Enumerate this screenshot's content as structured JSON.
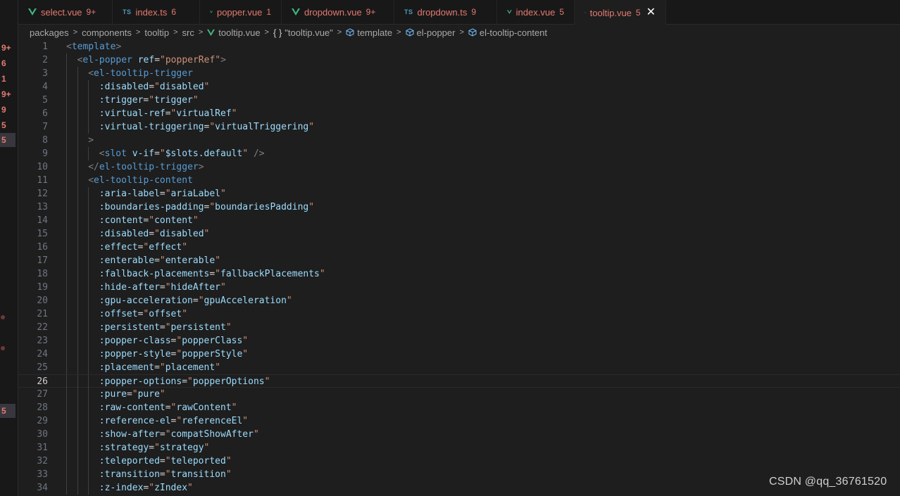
{
  "left_strip": {
    "badges": [
      "9+",
      "6",
      "1",
      "9+",
      "9",
      "5",
      "5"
    ],
    "extra_badge": "5"
  },
  "tabs": [
    {
      "icon": "vue-icon",
      "label": "select.vue",
      "badge": "9+",
      "active": false
    },
    {
      "icon": "ts-icon",
      "icon_text": "TS",
      "label": "index.ts",
      "badge": "6",
      "active": false
    },
    {
      "icon": "vue-icon",
      "label": "popper.vue",
      "badge": "1",
      "active": false
    },
    {
      "icon": "vue-icon",
      "label": "dropdown.vue",
      "badge": "9+",
      "active": false
    },
    {
      "icon": "ts-icon",
      "icon_text": "TS",
      "label": "dropdown.ts",
      "badge": "9",
      "active": false
    },
    {
      "icon": "vue-icon",
      "label": "index.vue",
      "badge": "5",
      "active": false
    },
    {
      "icon": "vue-icon",
      "label": "tooltip.vue",
      "badge": "5",
      "active": true,
      "close": "✕"
    }
  ],
  "breadcrumb": {
    "packages": "packages",
    "components": "components",
    "tooltip": "tooltip",
    "src": "src",
    "file": "tooltip.vue",
    "braces": "{ }",
    "sfc": "\"tooltip.vue\"",
    "template": "template",
    "popper": "el-popper",
    "content": "el-tooltip-content"
  },
  "editor": {
    "current_line": 26,
    "lines": [
      {
        "n": "1",
        "i": 0,
        "tokens": [
          [
            "t-punc",
            "<"
          ],
          [
            "t-tag",
            "template"
          ],
          [
            "t-punc",
            ">"
          ]
        ]
      },
      {
        "n": "2",
        "i": 1,
        "tokens": [
          [
            "t-punc",
            "<"
          ],
          [
            "t-tag",
            "el-popper"
          ],
          [
            "t-text",
            " "
          ],
          [
            "t-attr",
            "ref"
          ],
          [
            "t-text",
            "="
          ],
          [
            "t-str",
            "\"popperRef\""
          ],
          [
            "t-punc",
            ">"
          ]
        ]
      },
      {
        "n": "3",
        "i": 2,
        "tokens": [
          [
            "t-punc",
            "<"
          ],
          [
            "t-tag",
            "el-tooltip-trigger"
          ]
        ]
      },
      {
        "n": "4",
        "i": 3,
        "tokens": [
          [
            "t-dir",
            ":disabled"
          ],
          [
            "t-text",
            "="
          ],
          [
            "t-str",
            "\""
          ],
          [
            "t-attr",
            "disabled"
          ],
          [
            "t-str",
            "\""
          ]
        ]
      },
      {
        "n": "5",
        "i": 3,
        "tokens": [
          [
            "t-dir",
            ":trigger"
          ],
          [
            "t-text",
            "="
          ],
          [
            "t-str",
            "\""
          ],
          [
            "t-attr",
            "trigger"
          ],
          [
            "t-str",
            "\""
          ]
        ]
      },
      {
        "n": "6",
        "i": 3,
        "tokens": [
          [
            "t-dir",
            ":virtual-ref"
          ],
          [
            "t-text",
            "="
          ],
          [
            "t-str",
            "\""
          ],
          [
            "t-attr",
            "virtualRef"
          ],
          [
            "t-str",
            "\""
          ]
        ]
      },
      {
        "n": "7",
        "i": 3,
        "tokens": [
          [
            "t-dir",
            ":virtual-triggering"
          ],
          [
            "t-text",
            "="
          ],
          [
            "t-str",
            "\""
          ],
          [
            "t-attr",
            "virtualTriggering"
          ],
          [
            "t-str",
            "\""
          ]
        ]
      },
      {
        "n": "8",
        "i": 2,
        "tokens": [
          [
            "t-punc",
            ">"
          ]
        ]
      },
      {
        "n": "9",
        "i": 3,
        "tokens": [
          [
            "t-punc",
            "<"
          ],
          [
            "t-tag",
            "slot"
          ],
          [
            "t-text",
            " "
          ],
          [
            "t-attr",
            "v-if"
          ],
          [
            "t-text",
            "="
          ],
          [
            "t-str",
            "\""
          ],
          [
            "t-attr",
            "$slots.default"
          ],
          [
            "t-str",
            "\""
          ],
          [
            "t-text",
            " "
          ],
          [
            "t-punc",
            "/>"
          ]
        ]
      },
      {
        "n": "10",
        "i": 2,
        "tokens": [
          [
            "t-punc",
            "</"
          ],
          [
            "t-tag",
            "el-tooltip-trigger"
          ],
          [
            "t-punc",
            ">"
          ]
        ]
      },
      {
        "n": "11",
        "i": 2,
        "tokens": [
          [
            "t-punc",
            "<"
          ],
          [
            "t-tag",
            "el-tooltip-content"
          ]
        ]
      },
      {
        "n": "12",
        "i": 3,
        "tokens": [
          [
            "t-dir",
            ":aria-label"
          ],
          [
            "t-text",
            "="
          ],
          [
            "t-str",
            "\""
          ],
          [
            "t-attr",
            "ariaLabel"
          ],
          [
            "t-str",
            "\""
          ]
        ]
      },
      {
        "n": "13",
        "i": 3,
        "tokens": [
          [
            "t-dir",
            ":boundaries-padding"
          ],
          [
            "t-text",
            "="
          ],
          [
            "t-str",
            "\""
          ],
          [
            "t-attr",
            "boundariesPadding"
          ],
          [
            "t-str",
            "\""
          ]
        ]
      },
      {
        "n": "14",
        "i": 3,
        "tokens": [
          [
            "t-dir",
            ":content"
          ],
          [
            "t-text",
            "="
          ],
          [
            "t-str",
            "\""
          ],
          [
            "t-attr",
            "content"
          ],
          [
            "t-str",
            "\""
          ]
        ]
      },
      {
        "n": "15",
        "i": 3,
        "tokens": [
          [
            "t-dir",
            ":disabled"
          ],
          [
            "t-text",
            "="
          ],
          [
            "t-str",
            "\""
          ],
          [
            "t-attr",
            "disabled"
          ],
          [
            "t-str",
            "\""
          ]
        ]
      },
      {
        "n": "16",
        "i": 3,
        "tokens": [
          [
            "t-dir",
            ":effect"
          ],
          [
            "t-text",
            "="
          ],
          [
            "t-str",
            "\""
          ],
          [
            "t-attr",
            "effect"
          ],
          [
            "t-str",
            "\""
          ]
        ]
      },
      {
        "n": "17",
        "i": 3,
        "tokens": [
          [
            "t-dir",
            ":enterable"
          ],
          [
            "t-text",
            "="
          ],
          [
            "t-str",
            "\""
          ],
          [
            "t-attr",
            "enterable"
          ],
          [
            "t-str",
            "\""
          ]
        ]
      },
      {
        "n": "18",
        "i": 3,
        "tokens": [
          [
            "t-dir",
            ":fallback-placements"
          ],
          [
            "t-text",
            "="
          ],
          [
            "t-str",
            "\""
          ],
          [
            "t-attr",
            "fallbackPlacements"
          ],
          [
            "t-str",
            "\""
          ]
        ]
      },
      {
        "n": "19",
        "i": 3,
        "tokens": [
          [
            "t-dir",
            ":hide-after"
          ],
          [
            "t-text",
            "="
          ],
          [
            "t-str",
            "\""
          ],
          [
            "t-attr",
            "hideAfter"
          ],
          [
            "t-str",
            "\""
          ]
        ]
      },
      {
        "n": "20",
        "i": 3,
        "tokens": [
          [
            "t-dir",
            ":gpu-acceleration"
          ],
          [
            "t-text",
            "="
          ],
          [
            "t-str",
            "\""
          ],
          [
            "t-attr",
            "gpuAcceleration"
          ],
          [
            "t-str",
            "\""
          ]
        ]
      },
      {
        "n": "21",
        "i": 3,
        "tokens": [
          [
            "t-dir",
            ":offset"
          ],
          [
            "t-text",
            "="
          ],
          [
            "t-str",
            "\""
          ],
          [
            "t-attr",
            "offset"
          ],
          [
            "t-str",
            "\""
          ]
        ]
      },
      {
        "n": "22",
        "i": 3,
        "tokens": [
          [
            "t-dir",
            ":persistent"
          ],
          [
            "t-text",
            "="
          ],
          [
            "t-str",
            "\""
          ],
          [
            "t-attr",
            "persistent"
          ],
          [
            "t-str",
            "\""
          ]
        ]
      },
      {
        "n": "23",
        "i": 3,
        "tokens": [
          [
            "t-dir",
            ":popper-class"
          ],
          [
            "t-text",
            "="
          ],
          [
            "t-str",
            "\""
          ],
          [
            "t-attr",
            "popperClass"
          ],
          [
            "t-str",
            "\""
          ]
        ]
      },
      {
        "n": "24",
        "i": 3,
        "tokens": [
          [
            "t-dir",
            ":popper-style"
          ],
          [
            "t-text",
            "="
          ],
          [
            "t-str",
            "\""
          ],
          [
            "t-attr",
            "popperStyle"
          ],
          [
            "t-str",
            "\""
          ]
        ]
      },
      {
        "n": "25",
        "i": 3,
        "tokens": [
          [
            "t-dir",
            ":placement"
          ],
          [
            "t-text",
            "="
          ],
          [
            "t-str",
            "\""
          ],
          [
            "t-attr",
            "placement"
          ],
          [
            "t-str",
            "\""
          ]
        ]
      },
      {
        "n": "26",
        "i": 3,
        "tokens": [
          [
            "t-dir",
            ":popper-options"
          ],
          [
            "t-text",
            "="
          ],
          [
            "t-str",
            "\""
          ],
          [
            "t-attr",
            "popperOptions"
          ],
          [
            "t-str",
            "\""
          ]
        ]
      },
      {
        "n": "27",
        "i": 3,
        "tokens": [
          [
            "t-dir",
            ":pure"
          ],
          [
            "t-text",
            "="
          ],
          [
            "t-str",
            "\""
          ],
          [
            "t-attr",
            "pure"
          ],
          [
            "t-str",
            "\""
          ]
        ]
      },
      {
        "n": "28",
        "i": 3,
        "tokens": [
          [
            "t-dir",
            ":raw-content"
          ],
          [
            "t-text",
            "="
          ],
          [
            "t-str",
            "\""
          ],
          [
            "t-attr",
            "rawContent"
          ],
          [
            "t-str",
            "\""
          ]
        ]
      },
      {
        "n": "29",
        "i": 3,
        "tokens": [
          [
            "t-dir",
            ":reference-el"
          ],
          [
            "t-text",
            "="
          ],
          [
            "t-str",
            "\""
          ],
          [
            "t-attr",
            "referenceEl"
          ],
          [
            "t-str",
            "\""
          ]
        ]
      },
      {
        "n": "30",
        "i": 3,
        "tokens": [
          [
            "t-dir",
            ":show-after"
          ],
          [
            "t-text",
            "="
          ],
          [
            "t-str",
            "\""
          ],
          [
            "t-attr",
            "compatShowAfter"
          ],
          [
            "t-str",
            "\""
          ]
        ]
      },
      {
        "n": "31",
        "i": 3,
        "tokens": [
          [
            "t-dir",
            ":strategy"
          ],
          [
            "t-text",
            "="
          ],
          [
            "t-str",
            "\""
          ],
          [
            "t-attr",
            "strategy"
          ],
          [
            "t-str",
            "\""
          ]
        ]
      },
      {
        "n": "32",
        "i": 3,
        "tokens": [
          [
            "t-dir",
            ":teleported"
          ],
          [
            "t-text",
            "="
          ],
          [
            "t-str",
            "\""
          ],
          [
            "t-attr",
            "teleported"
          ],
          [
            "t-str",
            "\""
          ]
        ]
      },
      {
        "n": "33",
        "i": 3,
        "tokens": [
          [
            "t-dir",
            ":transition"
          ],
          [
            "t-text",
            "="
          ],
          [
            "t-str",
            "\""
          ],
          [
            "t-attr",
            "transition"
          ],
          [
            "t-str",
            "\""
          ]
        ]
      },
      {
        "n": "34",
        "i": 3,
        "tokens": [
          [
            "t-dir",
            ":z-index"
          ],
          [
            "t-text",
            "="
          ],
          [
            "t-str",
            "\""
          ],
          [
            "t-attr",
            "zIndex"
          ],
          [
            "t-str",
            "\""
          ]
        ]
      }
    ]
  },
  "watermark": "CSDN @qq_36761520",
  "colors": {
    "background": "#1e1e1e",
    "tab_error": "#e37b70",
    "vue_green": "#41b883",
    "ts_blue": "#519aba",
    "tag": "#569cd6",
    "attr": "#9cdcfe",
    "string": "#ce9178"
  }
}
